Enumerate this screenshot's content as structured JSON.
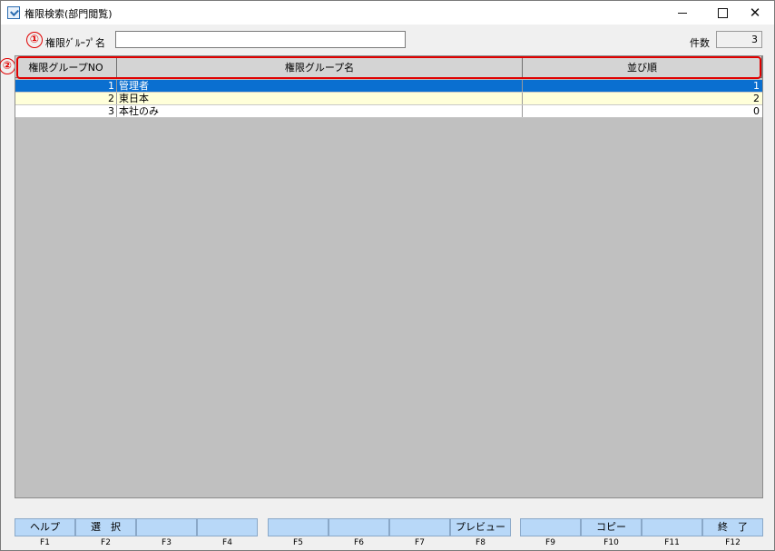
{
  "window": {
    "title": "権限検索(部門閲覧)",
    "minimize_icon": "minimize-icon",
    "maximize_icon": "maximize-icon",
    "close_glyph": "✕"
  },
  "markers": {
    "m1": "①",
    "m2": "②"
  },
  "search": {
    "label": "権限ｸﾞﾙｰﾌﾟ名",
    "value": "",
    "count_label": "件数",
    "count_value": "3"
  },
  "grid": {
    "columns": [
      "権限グループNO",
      "権限グループ名",
      "並び順"
    ],
    "rows": [
      {
        "no": "1",
        "name": "管理者",
        "order": "1"
      },
      {
        "no": "2",
        "name": "東日本",
        "order": "2"
      },
      {
        "no": "3",
        "name": "本社のみ",
        "order": "0"
      }
    ]
  },
  "fkeys": {
    "buttons": [
      "ヘルプ",
      "選　択",
      "",
      "",
      "",
      "",
      "",
      "プレビュー",
      "",
      "コピー",
      "",
      "終　了"
    ],
    "labels": [
      "F1",
      "F2",
      "F3",
      "F4",
      "F5",
      "F6",
      "F7",
      "F8",
      "F9",
      "F10",
      "F11",
      "F12"
    ]
  },
  "colors": {
    "selection": "#0a6fd0",
    "alt_row": "#ffffd9",
    "fkey_bg": "#b8d8f8",
    "annotation": "#e00000"
  }
}
